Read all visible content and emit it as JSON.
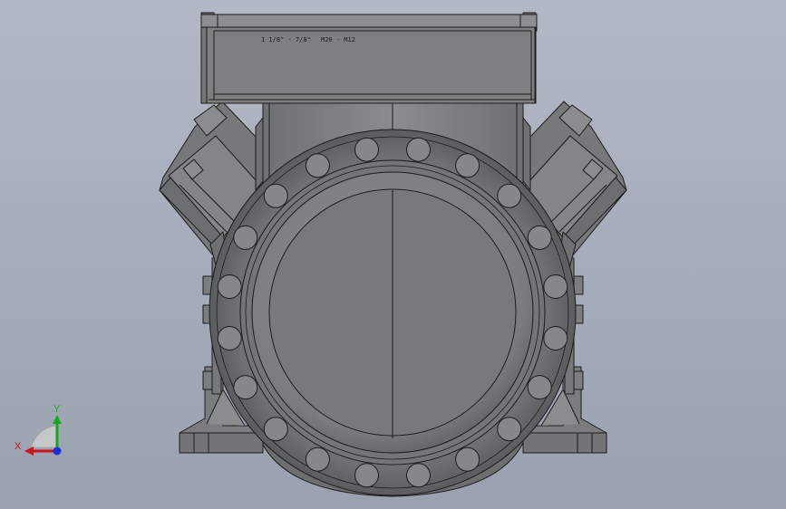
{
  "viewport": {
    "background_top": "#b3b9c4",
    "background_bottom": "#9aa2b0"
  },
  "model": {
    "labels": {
      "left": "1 1/8\" - 7/8\"",
      "right": "M20 - M12"
    },
    "colors": {
      "body": "#7b7d7f",
      "body_light": "#8d8f91",
      "body_dark": "#5f6163",
      "edge": "#1c1c1c"
    },
    "flange_bolt_count": 20
  },
  "triad": {
    "x_label": "X",
    "y_label": "Y",
    "x_color": "#c8141b",
    "y_color": "#19a51d",
    "z_color": "#1b2fd8"
  }
}
